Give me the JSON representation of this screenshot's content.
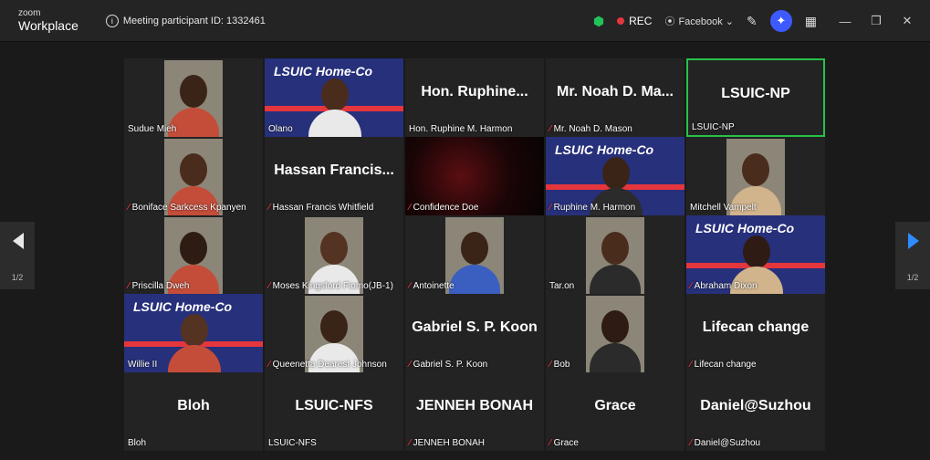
{
  "app": {
    "brand_line1": "zoom",
    "brand_line2": "Workplace"
  },
  "meeting": {
    "participant_id_label": "Meeting participant ID: 1332461"
  },
  "toolbar": {
    "rec_label": "REC",
    "facebook_label": "Facebook ⌄"
  },
  "pager": {
    "left_page": "1/2",
    "right_page": "1/2"
  },
  "tiles": [
    {
      "label": "Sudue Mieh",
      "muted": false,
      "kind": "video"
    },
    {
      "label": "Olano",
      "muted": false,
      "kind": "poster"
    },
    {
      "label": "Hon. Ruphine M. Harmon",
      "display": "Hon. Ruphine...",
      "muted": false,
      "kind": "name"
    },
    {
      "label": "Mr. Noah D. Mason",
      "display": "Mr. Noah D. Ma...",
      "muted": true,
      "kind": "name"
    },
    {
      "label": "LSUIC-NP",
      "display": "LSUIC-NP",
      "muted": false,
      "kind": "name",
      "active": true
    },
    {
      "label": "Boniface Sarkcess Kpanyen",
      "muted": true,
      "kind": "video"
    },
    {
      "label": "Hassan Francis Whitfield",
      "display": "Hassan Francis...",
      "muted": true,
      "kind": "name"
    },
    {
      "label": "Confidence Doe",
      "muted": true,
      "kind": "dark"
    },
    {
      "label": "Ruphine M. Harmon",
      "muted": true,
      "kind": "poster"
    },
    {
      "label": "Mitchell Vampelt",
      "muted": false,
      "kind": "video"
    },
    {
      "label": "Priscilla Dweh",
      "muted": true,
      "kind": "video"
    },
    {
      "label": "Moses Kingsford Fiomo(JB-1)",
      "muted": true,
      "kind": "video"
    },
    {
      "label": "Antoinette",
      "muted": true,
      "kind": "video"
    },
    {
      "label": "Tar.on",
      "muted": false,
      "kind": "video"
    },
    {
      "label": "Abraham Dixon",
      "muted": true,
      "kind": "poster"
    },
    {
      "label": "Willie II",
      "muted": false,
      "kind": "poster"
    },
    {
      "label": "Queenetta Dearest Johnson",
      "muted": true,
      "kind": "video"
    },
    {
      "label": "Gabriel S. P. Koon",
      "display": "Gabriel S. P. Koon",
      "muted": true,
      "kind": "name"
    },
    {
      "label": "Bob",
      "muted": true,
      "kind": "video"
    },
    {
      "label": "Lifecan change",
      "display": "Lifecan change",
      "muted": true,
      "kind": "name"
    },
    {
      "label": "Bloh",
      "display": "Bloh",
      "muted": false,
      "kind": "name"
    },
    {
      "label": "LSUIC-NFS",
      "display": "LSUIC-NFS",
      "muted": false,
      "kind": "name"
    },
    {
      "label": "JENNEH BONAH",
      "display": "JENNEH BONAH",
      "muted": true,
      "kind": "name"
    },
    {
      "label": "Grace",
      "display": "Grace",
      "muted": true,
      "kind": "name"
    },
    {
      "label": "Daniel@Suzhou",
      "display": "Daniel@Suzhou",
      "muted": true,
      "kind": "name"
    }
  ],
  "poster_text": "LSUIC Home-Co",
  "colors": {
    "accent_blue": "#2d8cff",
    "mute_red": "#e5363d",
    "active_green": "#26c24a",
    "rec_red": "#e5363d"
  }
}
